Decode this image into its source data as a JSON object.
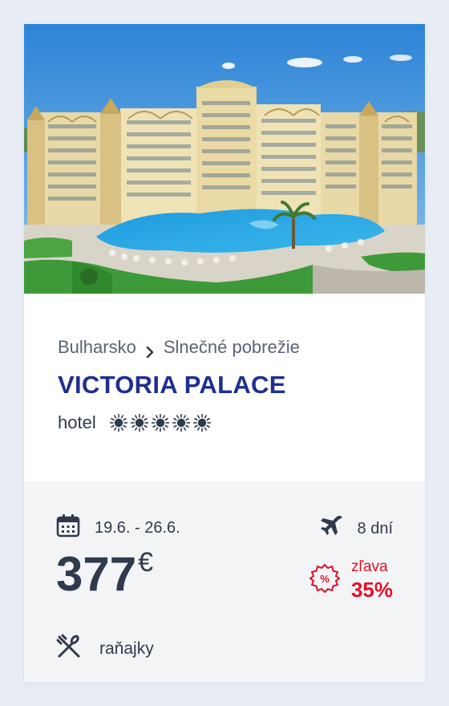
{
  "colors": {
    "title": "#1f2f8f",
    "discount": "#e0102a",
    "text": "#2f3a4d",
    "muted": "#5a6275"
  },
  "breadcrumb": {
    "country": "Bulharsko",
    "region": "Slnečné pobrežie"
  },
  "hotel": {
    "name": "VICTORIA PALACE",
    "type": "hotel",
    "rating_suns": 5
  },
  "trip": {
    "dates": "19.6. - 26.6.",
    "duration": "8 dní"
  },
  "price": {
    "amount": "377",
    "currency": "€"
  },
  "discount": {
    "label": "zľava",
    "value": "35%",
    "badge": "%"
  },
  "board": {
    "label": "raňajky"
  },
  "icons": {
    "calendar": "calendar-icon",
    "plane": "plane-icon",
    "meal": "fork-knife-icon",
    "discount": "discount-badge-icon",
    "chevron": "chevron-right-icon",
    "sun": "sun-icon"
  }
}
